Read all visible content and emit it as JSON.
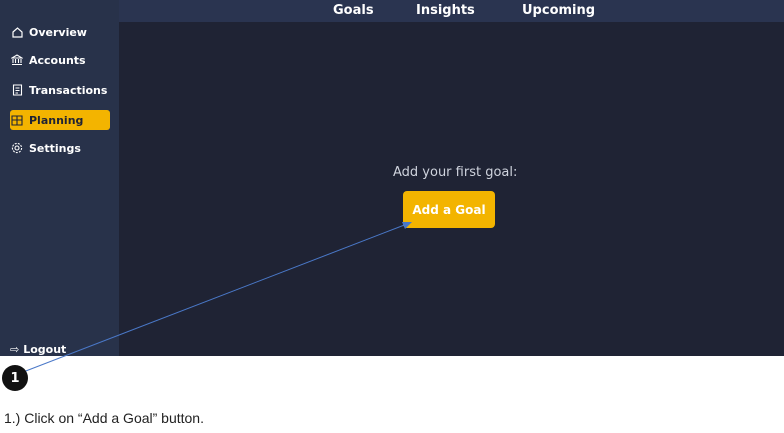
{
  "topnav": {
    "tabs": [
      "Goals",
      "Insights",
      "Upcoming"
    ]
  },
  "sidebar": {
    "items": [
      {
        "label": "Overview",
        "icon": "home-icon"
      },
      {
        "label": "Accounts",
        "icon": "bank-icon"
      },
      {
        "label": "Transactions",
        "icon": "receipt-icon"
      },
      {
        "label": "Planning",
        "icon": "planning-icon",
        "active": true
      },
      {
        "label": "Settings",
        "icon": "gear-icon"
      }
    ],
    "logout_label": "Logout"
  },
  "main": {
    "prompt": "Add your first goal:",
    "add_goal_label": "Add a Goal"
  },
  "annotation": {
    "marker": "1",
    "instruction": "1.)  Click on “Add a Goal” button."
  },
  "colors": {
    "accent": "#f3b400",
    "sidebar": "#28324a",
    "background": "#1f2334"
  }
}
